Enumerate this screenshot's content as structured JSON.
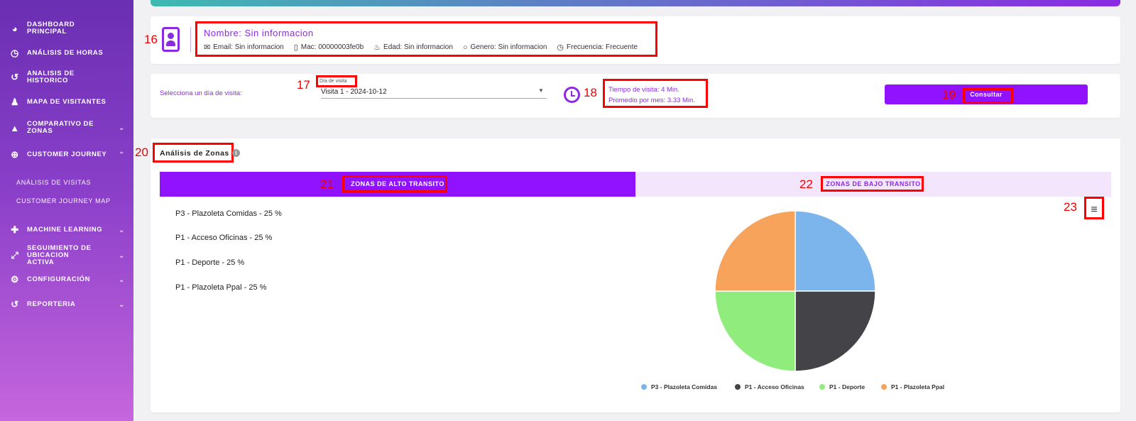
{
  "sidebar": {
    "items": [
      {
        "label": "DASHBOARD PRINCIPAL",
        "icon": "gauge-icon",
        "glyph": "◕"
      },
      {
        "label": "ANÁLISIS DE HORAS",
        "icon": "clock-icon",
        "glyph": "◷"
      },
      {
        "label": "ANALISIS DE HISTORICO",
        "icon": "history-icon",
        "glyph": "↺"
      },
      {
        "label": "MAPA DE VISITANTES",
        "icon": "person-map-icon",
        "glyph": "♟"
      },
      {
        "label": "COMPARATIVO DE ZONAS",
        "icon": "area-chart-icon",
        "glyph": "▲"
      },
      {
        "label": "CUSTOMER JOURNEY",
        "icon": "search-plus-icon",
        "glyph": "⊕"
      },
      {
        "label": "MACHINE LEARNING",
        "icon": "puzzle-icon",
        "glyph": "✚"
      },
      {
        "label": "SEGUIMIENTO DE UBICACION ACTIVA",
        "icon": "expand-icon",
        "glyph": "⤢"
      },
      {
        "label": "CONFIGURACIÓN",
        "icon": "gear-icon",
        "glyph": "⚙"
      },
      {
        "label": "REPORTERIA",
        "icon": "history-icon",
        "glyph": "↺"
      }
    ],
    "sub_items": [
      "ANÁLISIS DE VISITAS",
      "CUSTOMER JOURNEY MAP"
    ]
  },
  "annotations": [
    "16",
    "17",
    "18",
    "19",
    "20",
    "21",
    "22",
    "23"
  ],
  "profile": {
    "name": "Nombre: Sin informacion",
    "email": "Email: Sin informacion",
    "mac": "Mac: 00000003fe0b",
    "edad": "Edad: Sin informacion",
    "genero": "Genero: Sin informacion",
    "frecuencia": "Frecuencia: Frecuente"
  },
  "visit": {
    "select_label": "Selecciona un día de visita:",
    "field_label": "Día de visita",
    "field_value": "Visita 1 - 2024-10-12",
    "tiempo": "Tiempo de visita: 4 Min.",
    "promedio": "Promedio por mes: 3.33 Min.",
    "consultar": "Consultar"
  },
  "zones": {
    "title": "Análisis de Zonas",
    "info": "i",
    "tab_alto": "ZONAS DE ALTO TRANSITO",
    "tab_bajo": "ZONAS DE BAJO TRANSITO",
    "menu": "≡",
    "list": [
      "P3 - Plazoleta Comidas - 25 %",
      "P1 - Acceso Oficinas - 25 %",
      "P1 - Deporte - 25 %",
      "P1 - Plazoleta Ppal - 25 %"
    ]
  },
  "chart_data": {
    "type": "pie",
    "title": "",
    "legend_position": "bottom",
    "slices": [
      {
        "label": "P3 - Plazoleta Comidas",
        "value": 25,
        "color": "#7cb5ec"
      },
      {
        "label": "P1 - Acceso Oficinas",
        "value": 25,
        "color": "#434348"
      },
      {
        "label": "P1 - Deporte",
        "value": 25,
        "color": "#90ed7d"
      },
      {
        "label": "P1 - Plazoleta Ppal",
        "value": 25,
        "color": "#f7a35c"
      }
    ]
  },
  "colors": {
    "accent": "#9012fe",
    "highlight": "#ff0000"
  }
}
